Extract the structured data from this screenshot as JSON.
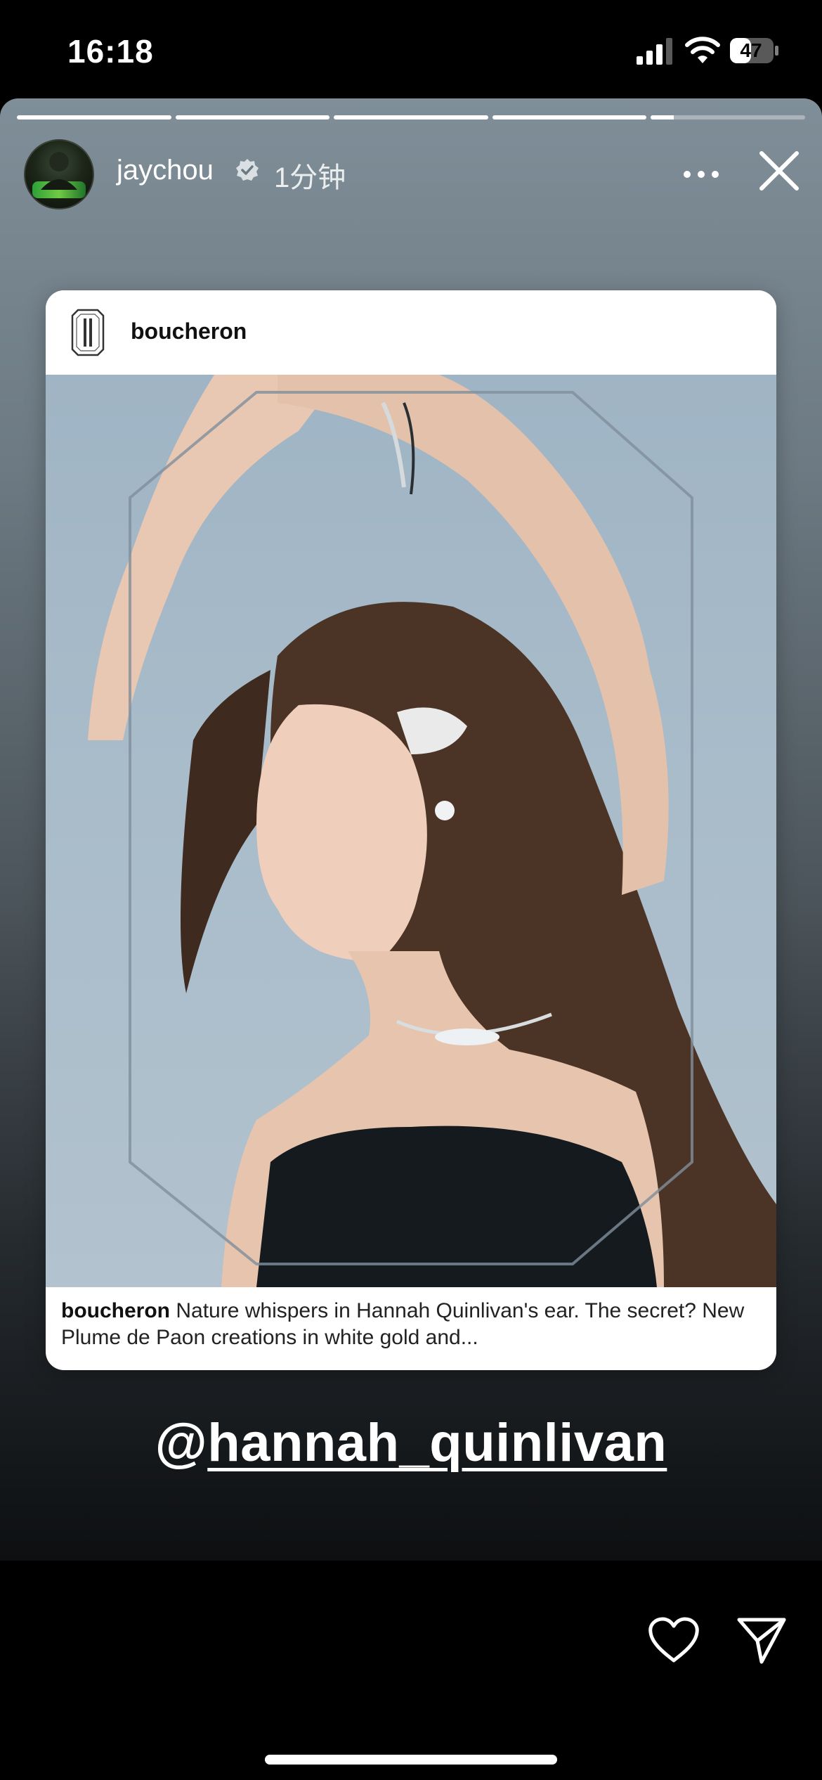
{
  "status_bar": {
    "time": "16:18",
    "battery_level": "47",
    "icons": [
      "cellular-signal-icon",
      "wifi-icon",
      "battery-icon"
    ]
  },
  "story": {
    "progress_segments": [
      1,
      1,
      1,
      1,
      0.15
    ],
    "user": {
      "username": "jaychou",
      "verified": true,
      "time_ago": "1分钟",
      "avatar_icon": "avatar-image"
    },
    "more_icon": "more-horizontal-icon",
    "close_icon": "close-icon"
  },
  "shared_post": {
    "account": "boucheron",
    "logo_icon": "boucheron-logo-icon",
    "image_alt": "boucheron post image",
    "caption_user": "boucheron",
    "caption_text": "Nature whispers in Hannah Quinlivan's ear. The secret? New Plume de Paon creations in white gold and..."
  },
  "mention": {
    "at": "@",
    "handle": "hannah_quinlivan"
  },
  "actions": {
    "like_icon": "heart-icon",
    "send_icon": "send-icon"
  },
  "colors": {
    "story_top": "#7f8e98",
    "story_bottom": "#0d0f11",
    "photo_bg": "#a9bcca",
    "dress": "#141a1e"
  }
}
